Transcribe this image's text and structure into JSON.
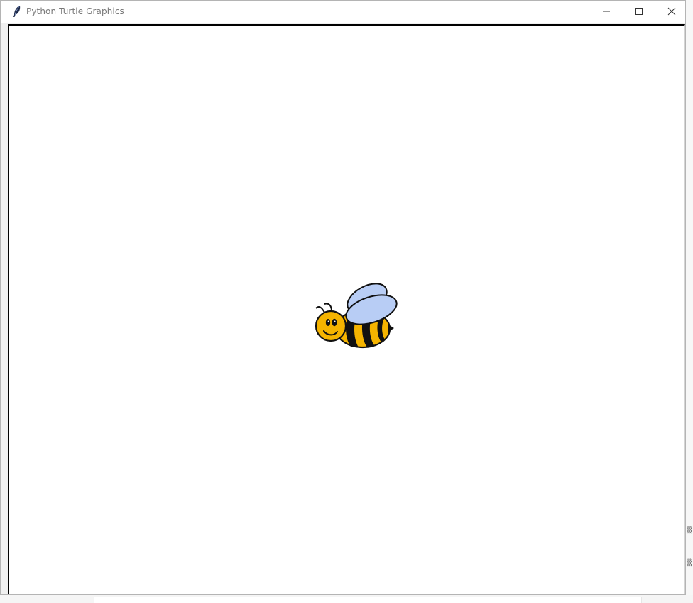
{
  "window": {
    "title": "Python Turtle Graphics",
    "app_icon": "feather-icon",
    "controls": {
      "minimize_icon": "minimize-icon",
      "maximize_icon": "maximize-icon",
      "close_icon": "close-icon"
    }
  },
  "canvas": {
    "background": "#ffffff",
    "turtle_shape": "bee-image"
  },
  "colors": {
    "bee_body": "#f5b400",
    "bee_stripes": "#111111",
    "bee_wings": "#b8cdf5"
  }
}
